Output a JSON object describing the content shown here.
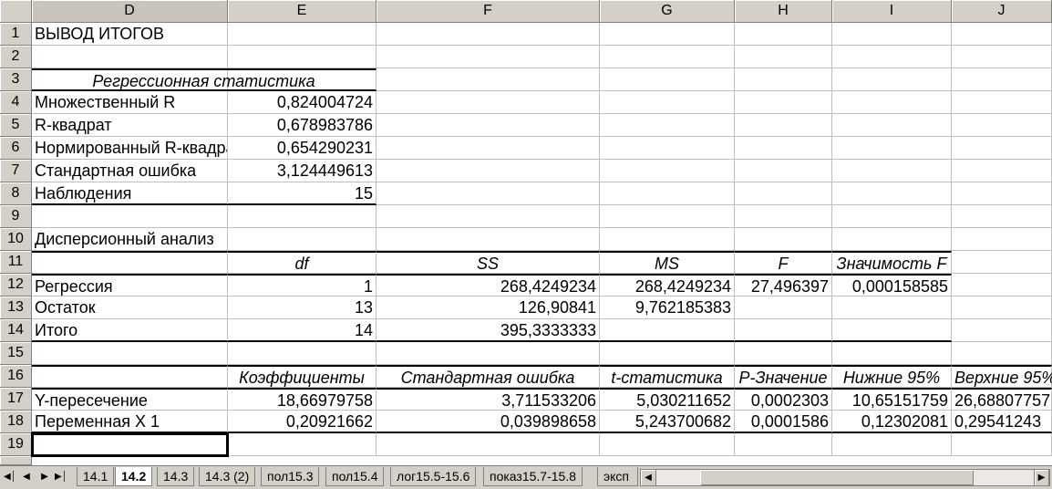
{
  "columns": [
    "D",
    "E",
    "F",
    "G",
    "H",
    "I",
    "J"
  ],
  "rows": [
    "1",
    "2",
    "3",
    "4",
    "5",
    "6",
    "7",
    "8",
    "9",
    "10",
    "11",
    "12",
    "13",
    "14",
    "15",
    "16",
    "17",
    "18",
    "19"
  ],
  "sheet": {
    "title": "ВЫВОД ИТОГОВ",
    "regstat_header": "Регрессионная статистика",
    "regstat": [
      {
        "label": "Множественный R",
        "value": "0,824004724"
      },
      {
        "label": "R-квадрат",
        "value": "0,678983786"
      },
      {
        "label": "Нормированный R-квадрат",
        "value": "0,654290231"
      },
      {
        "label": "Стандартная ошибка",
        "value": "3,124449613"
      },
      {
        "label": "Наблюдения",
        "value": "15"
      }
    ],
    "anova_title": "Дисперсионный анализ",
    "anova_headers": [
      "df",
      "SS",
      "MS",
      "F",
      "Значимость F"
    ],
    "anova_rows": [
      {
        "label": "Регрессия",
        "df": "1",
        "ss": "268,4249234",
        "ms": "268,4249234",
        "f": "27,496397",
        "sigf": "0,000158585"
      },
      {
        "label": "Остаток",
        "df": "13",
        "ss": "126,90841",
        "ms": "9,762185383",
        "f": "",
        "sigf": ""
      },
      {
        "label": "Итого",
        "df": "14",
        "ss": "395,3333333",
        "ms": "",
        "f": "",
        "sigf": ""
      }
    ],
    "coef_headers": [
      "Коэффициенты",
      "Стандартная ошибка",
      "t-статистика",
      "P-Значение",
      "Нижние 95%",
      "Верхние 95%"
    ],
    "coef_rows": [
      {
        "label": "Y-пересечение",
        "coef": "18,66979758",
        "se": "3,711533206",
        "t": "5,030211652",
        "p": "0,0002303",
        "low": "10,65151759",
        "up": "26,68807757"
      },
      {
        "label": "Переменная X 1",
        "coef": "0,20921662",
        "se": "0,039898658",
        "t": "5,243700682",
        "p": "0,0001586",
        "low": "0,12302081",
        "up": "0,29541243"
      }
    ]
  },
  "tabs": [
    "14.1",
    "14.2",
    "14.3",
    "14.3 (2)",
    "пол15.3",
    "пол15.4",
    "лог15.5-15.6",
    "показ15.7-15.8",
    "эксп"
  ],
  "active_tab": "14.2",
  "colors": {
    "header_bg": "#d4d0c8",
    "grid": "#c0c0c0"
  }
}
